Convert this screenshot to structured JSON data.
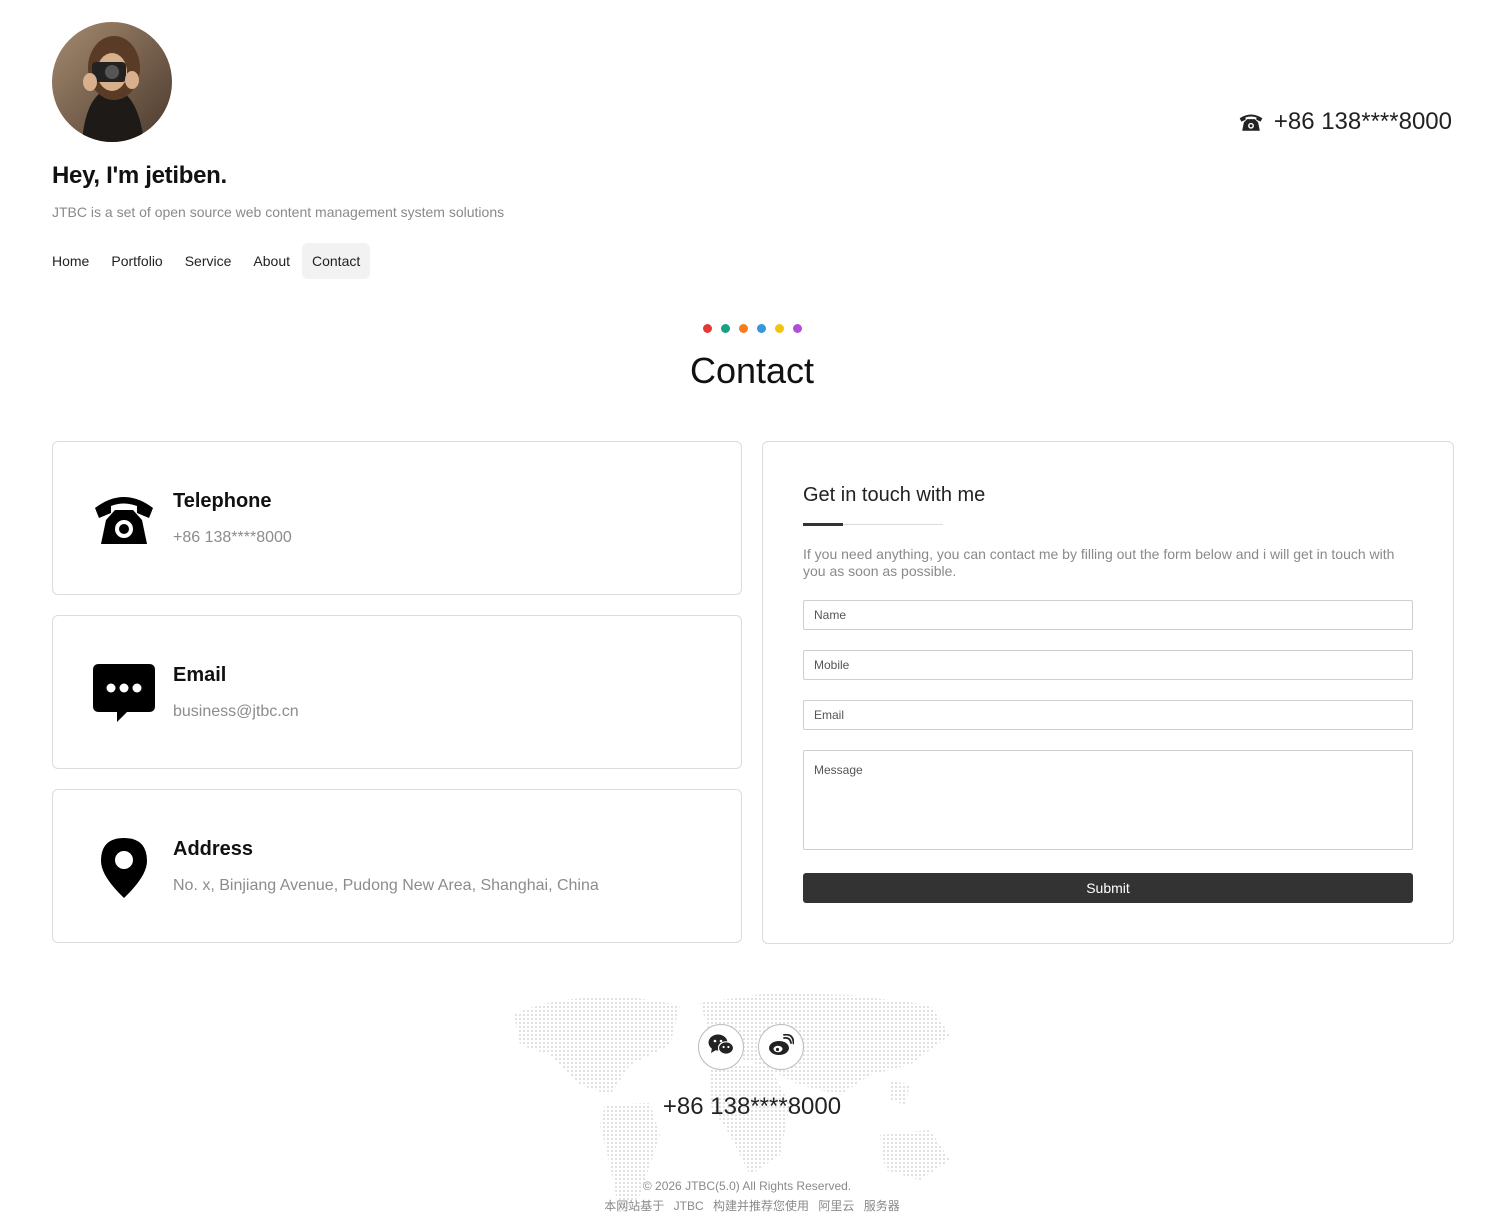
{
  "header": {
    "title": "Hey, I'm jetiben.",
    "subtitle": "JTBC is a set of open source web content management system solutions",
    "phone": "+86 138****8000"
  },
  "nav": {
    "items": [
      {
        "label": "Home"
      },
      {
        "label": "Portfolio"
      },
      {
        "label": "Service"
      },
      {
        "label": "About"
      },
      {
        "label": "Contact",
        "active": true
      }
    ]
  },
  "page": {
    "title": "Contact",
    "dot_colors": [
      "#e53935",
      "#16a085",
      "#f57c1f",
      "#3498db",
      "#f1c40f",
      "#b04fd8"
    ]
  },
  "contact_cards": [
    {
      "icon": "telephone-icon",
      "title": "Telephone",
      "value": "+86 138****8000"
    },
    {
      "icon": "speech-bubble-icon",
      "title": "Email",
      "value": "business@jtbc.cn"
    },
    {
      "icon": "map-pin-icon",
      "title": "Address",
      "value": "No. x, Binjiang Avenue, Pudong New Area, Shanghai, China"
    }
  ],
  "form": {
    "title": "Get in touch with me",
    "description": "If you need anything, you can contact me by filling out the form below and i will get in touch with you as soon as possible.",
    "name_placeholder": "Name",
    "mobile_placeholder": "Mobile",
    "email_placeholder": "Email",
    "message_placeholder": "Message",
    "submit_label": "Submit"
  },
  "footer": {
    "social": [
      "wechat-icon",
      "weibo-icon"
    ],
    "phone": "+86 138****8000",
    "copyright": "© 2026 JTBC(5.0) All Rights Reserved.",
    "beian": [
      "本网站基于",
      "JTBC",
      "构建并推荐您使用",
      "阿里云",
      "服务器"
    ]
  }
}
